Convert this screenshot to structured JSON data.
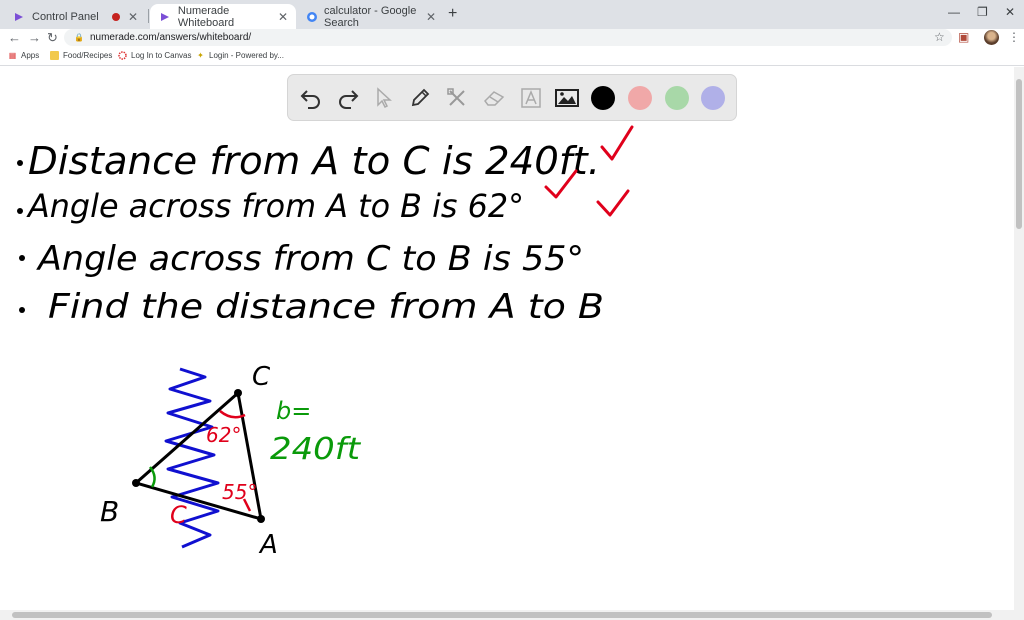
{
  "tabs": [
    {
      "label": "Control Panel",
      "icon": "numerade-logo-icon"
    },
    {
      "label": "Numerade Whiteboard",
      "icon": "numerade-logo-icon"
    },
    {
      "label": "calculator - Google Search",
      "icon": "google-icon"
    }
  ],
  "address": {
    "url": "numerade.com/answers/whiteboard/"
  },
  "bookmarks": [
    {
      "label": "Apps"
    },
    {
      "label": "Food/Recipes"
    },
    {
      "label": "Log In to Canvas"
    },
    {
      "label": "Login - Powered by..."
    }
  ],
  "toolbar": {
    "tools": [
      "undo-icon",
      "redo-icon",
      "pointer-icon",
      "pen-icon",
      "tools-icon",
      "eraser-icon",
      "text-icon",
      "image-icon"
    ],
    "colors": [
      "#000000",
      "#f0a8a8",
      "#a8d8a8",
      "#b0b0e8"
    ]
  },
  "whiteboard": {
    "lines": [
      "Distance from A to C is 240ft.",
      "Angle across from A to B is 62°",
      "Angle across from C to B is 55°",
      "Find the distance from A to B"
    ],
    "vertex_labels": [
      "C",
      "B",
      "A"
    ],
    "side_label_1": "b=",
    "side_label_2": "240ft",
    "angle_labels": [
      "62°",
      "55°",
      "C"
    ]
  },
  "colors": {
    "ink": "#000000",
    "check": "#e0001b",
    "blue": "#1010d0",
    "green": "#0a9a0a",
    "red": "#e0001b"
  }
}
